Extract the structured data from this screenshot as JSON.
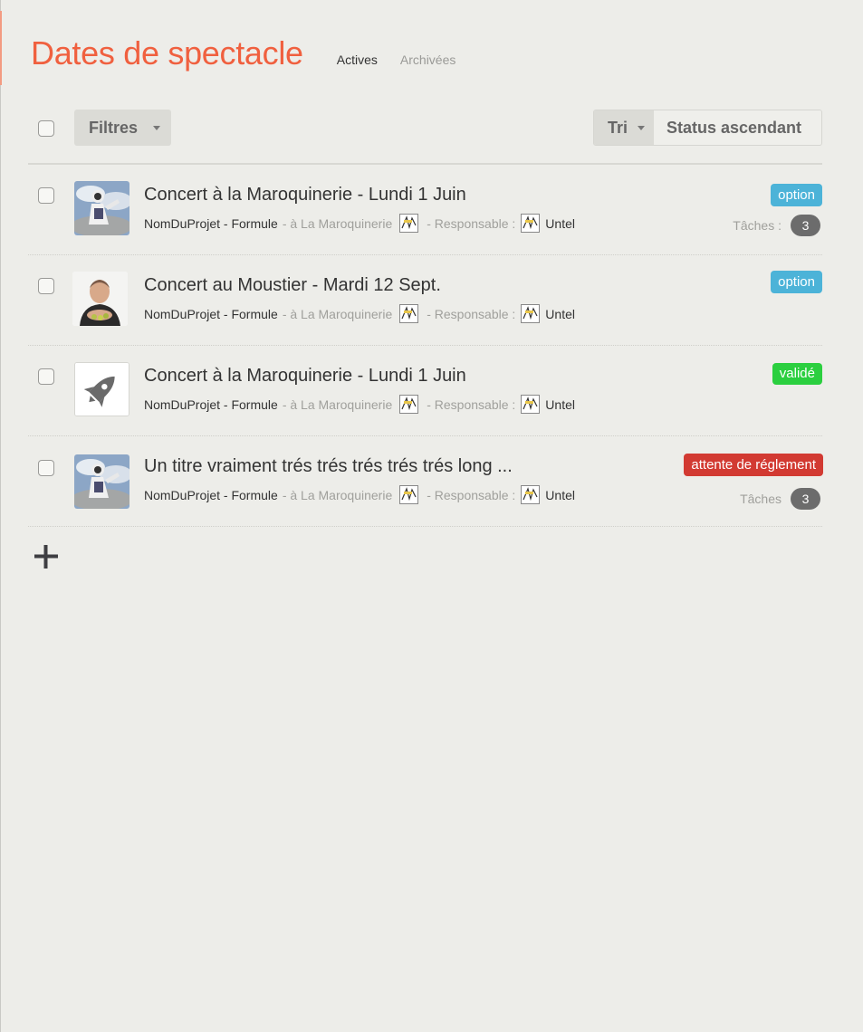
{
  "header": {
    "title": "Dates de spectacle",
    "tabs": [
      {
        "label": "Actives",
        "active": true
      },
      {
        "label": "Archivées",
        "active": false
      }
    ]
  },
  "toolbar": {
    "filter_label": "Filtres",
    "sort_label": "Tri",
    "sort_value": "Status ascendant"
  },
  "colors": {
    "title": "#f0603f",
    "option": "#4cb3d8",
    "valide": "#2bcf3f",
    "attente": "#d23a32"
  },
  "rows": [
    {
      "title": "Concert à la Maroquinerie - Lundi 1 Juin",
      "project": "NomDuProjet - Formule",
      "venue": "- à La Maroquinerie",
      "responsable_label": "- Responsable :",
      "responsable": "Untel",
      "status": "option",
      "thumb": "astronaut-photo",
      "tasks_label": "Tâches :",
      "tasks_count": "3"
    },
    {
      "title": "Concert au Moustier - Mardi 12 Sept.",
      "project": "NomDuProjet - Formule",
      "venue": "- à La Maroquinerie",
      "responsable_label": "- Responsable :",
      "responsable": "Untel",
      "status": "option",
      "thumb": "man-portrait-photo"
    },
    {
      "title": "Concert à la Maroquinerie - Lundi 1 Juin",
      "project": "NomDuProjet - Formule",
      "venue": "- à La Maroquinerie",
      "responsable_label": "- Responsable :",
      "responsable": "Untel",
      "status": "validé",
      "thumb": "rocket-icon"
    },
    {
      "title": "Un titre vraiment trés trés trés trés trés long ...",
      "project": "NomDuProjet - Formule",
      "venue": "- à La Maroquinerie",
      "responsable_label": "- Responsable :",
      "responsable": "Untel",
      "status": "attente de réglement",
      "thumb": "astronaut-photo",
      "tasks_label": "Tâches",
      "tasks_count": "3"
    }
  ]
}
